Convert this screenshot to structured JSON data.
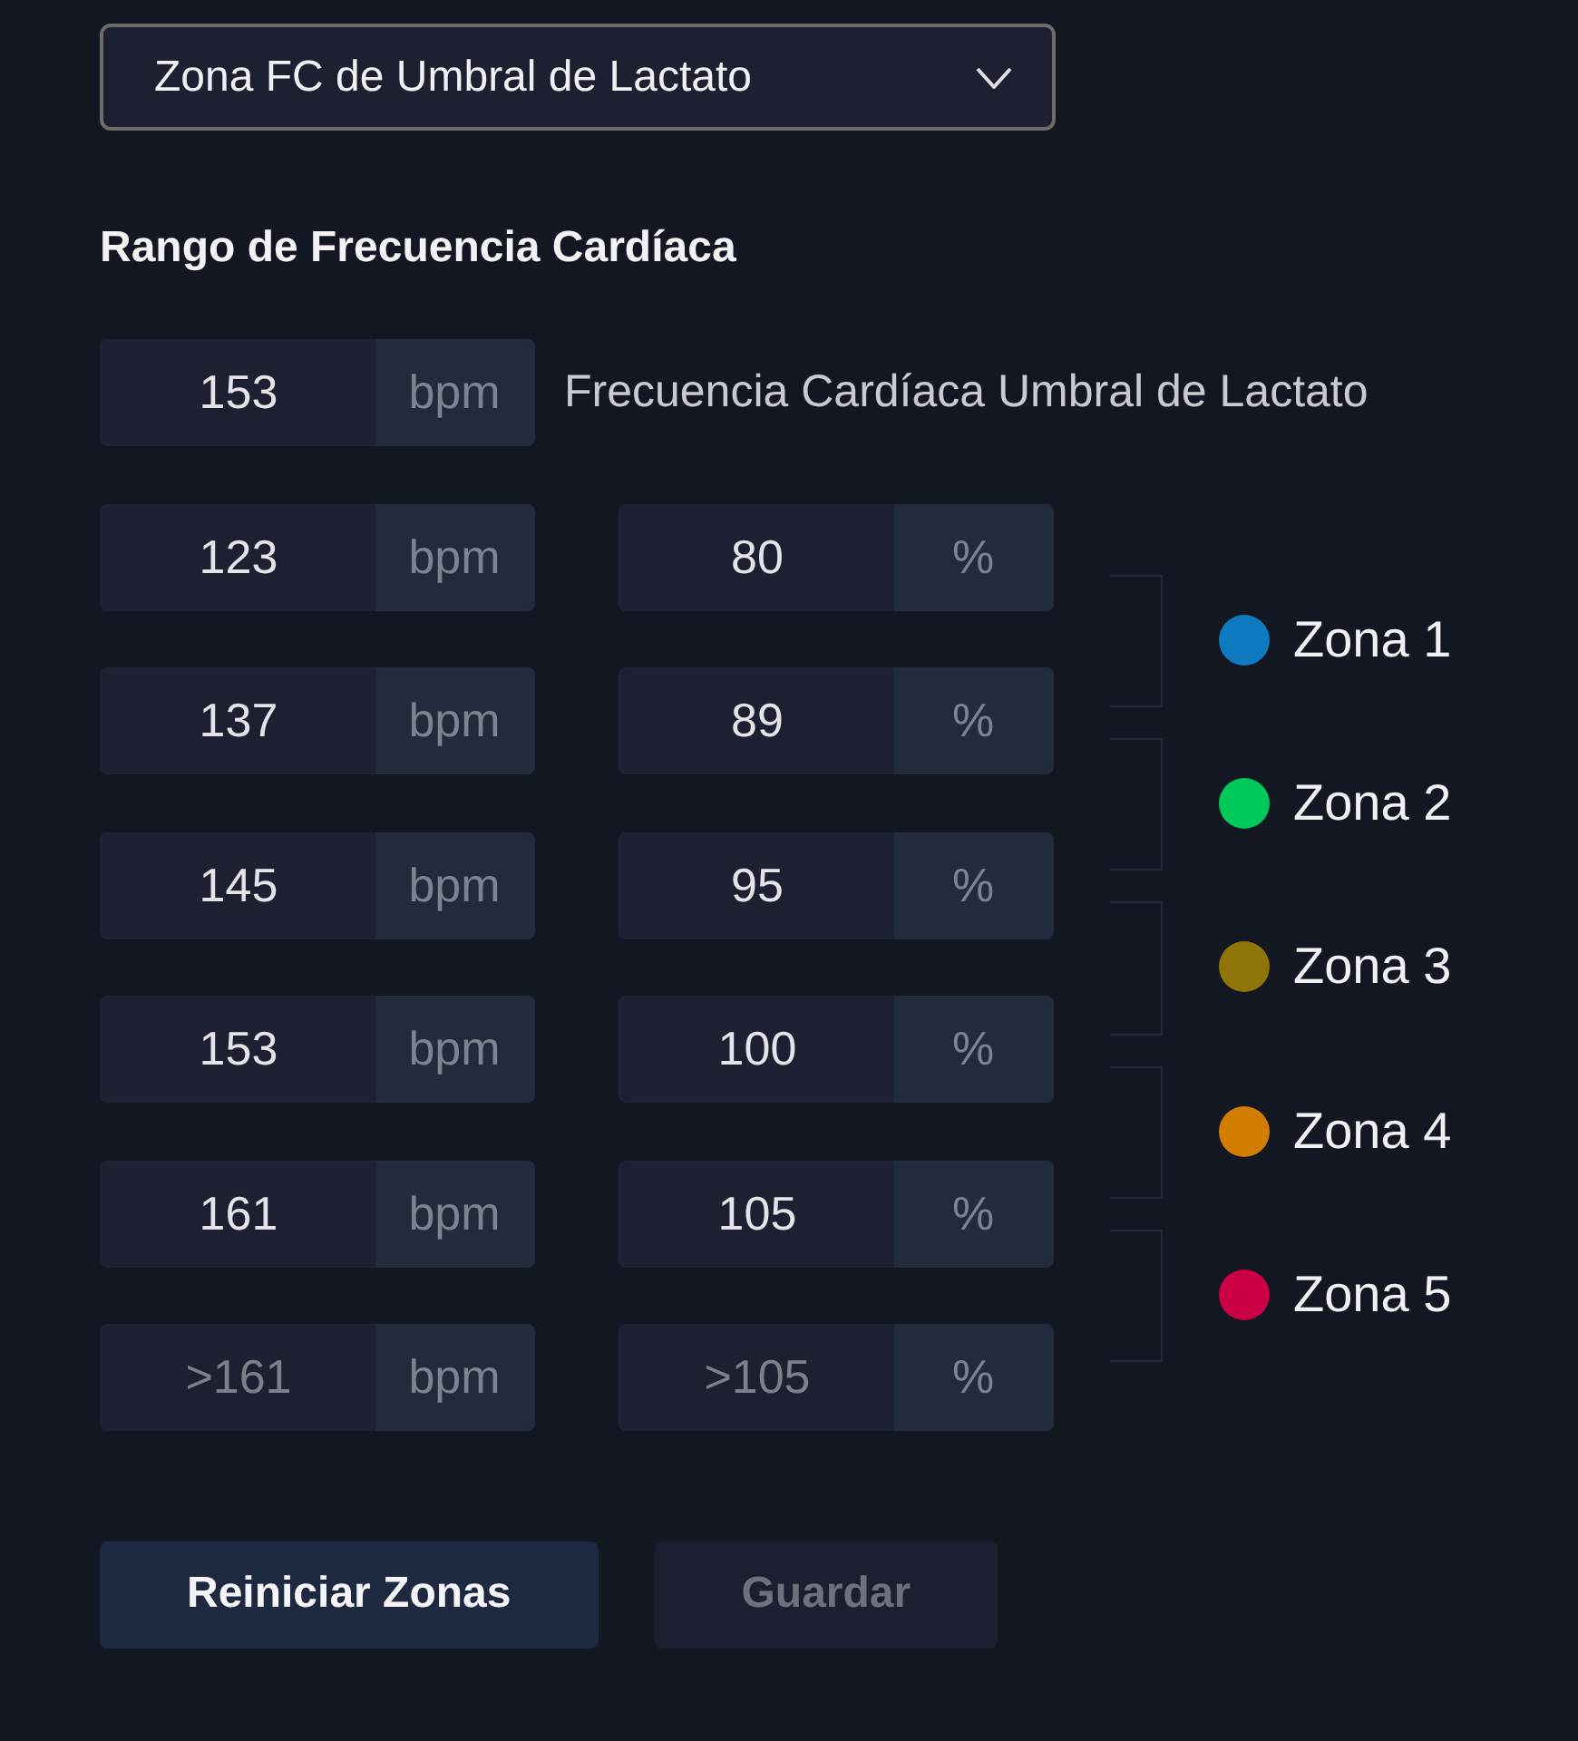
{
  "zone_method": {
    "value": "Zona FC de Umbral de Lactato"
  },
  "section_title": "Rango de Frecuencia Cardíaca",
  "threshold": {
    "value": "153",
    "unit": "bpm",
    "label": "Frecuencia Cardíaca Umbral de Lactato"
  },
  "boundaries": [
    {
      "hr": {
        "value": "123",
        "unit": "bpm"
      },
      "percent": {
        "value": "80",
        "unit": "%"
      },
      "disabled": false
    },
    {
      "hr": {
        "value": "137",
        "unit": "bpm"
      },
      "percent": {
        "value": "89",
        "unit": "%"
      },
      "disabled": false
    },
    {
      "hr": {
        "value": "145",
        "unit": "bpm"
      },
      "percent": {
        "value": "95",
        "unit": "%"
      },
      "disabled": false
    },
    {
      "hr": {
        "value": "153",
        "unit": "bpm"
      },
      "percent": {
        "value": "100",
        "unit": "%"
      },
      "disabled": false
    },
    {
      "hr": {
        "value": "161",
        "unit": "bpm"
      },
      "percent": {
        "value": "105",
        "unit": "%"
      },
      "disabled": false
    },
    {
      "hr": {
        "value": ">161",
        "unit": "bpm"
      },
      "percent": {
        "value": ">105",
        "unit": "%"
      },
      "disabled": true
    }
  ],
  "zones": [
    {
      "label": "Zona 1",
      "color": "#0e7bc0"
    },
    {
      "label": "Zona 2",
      "color": "#00c95c"
    },
    {
      "label": "Zona 3",
      "color": "#8f7509"
    },
    {
      "label": "Zona 4",
      "color": "#d17d00"
    },
    {
      "label": "Zona 5",
      "color": "#cc0044"
    }
  ],
  "buttons": [
    {
      "label": "Reiniciar Zonas",
      "kind": "primary",
      "disabled": false
    },
    {
      "label": "Guardar",
      "kind": "primary",
      "disabled": true
    }
  ]
}
